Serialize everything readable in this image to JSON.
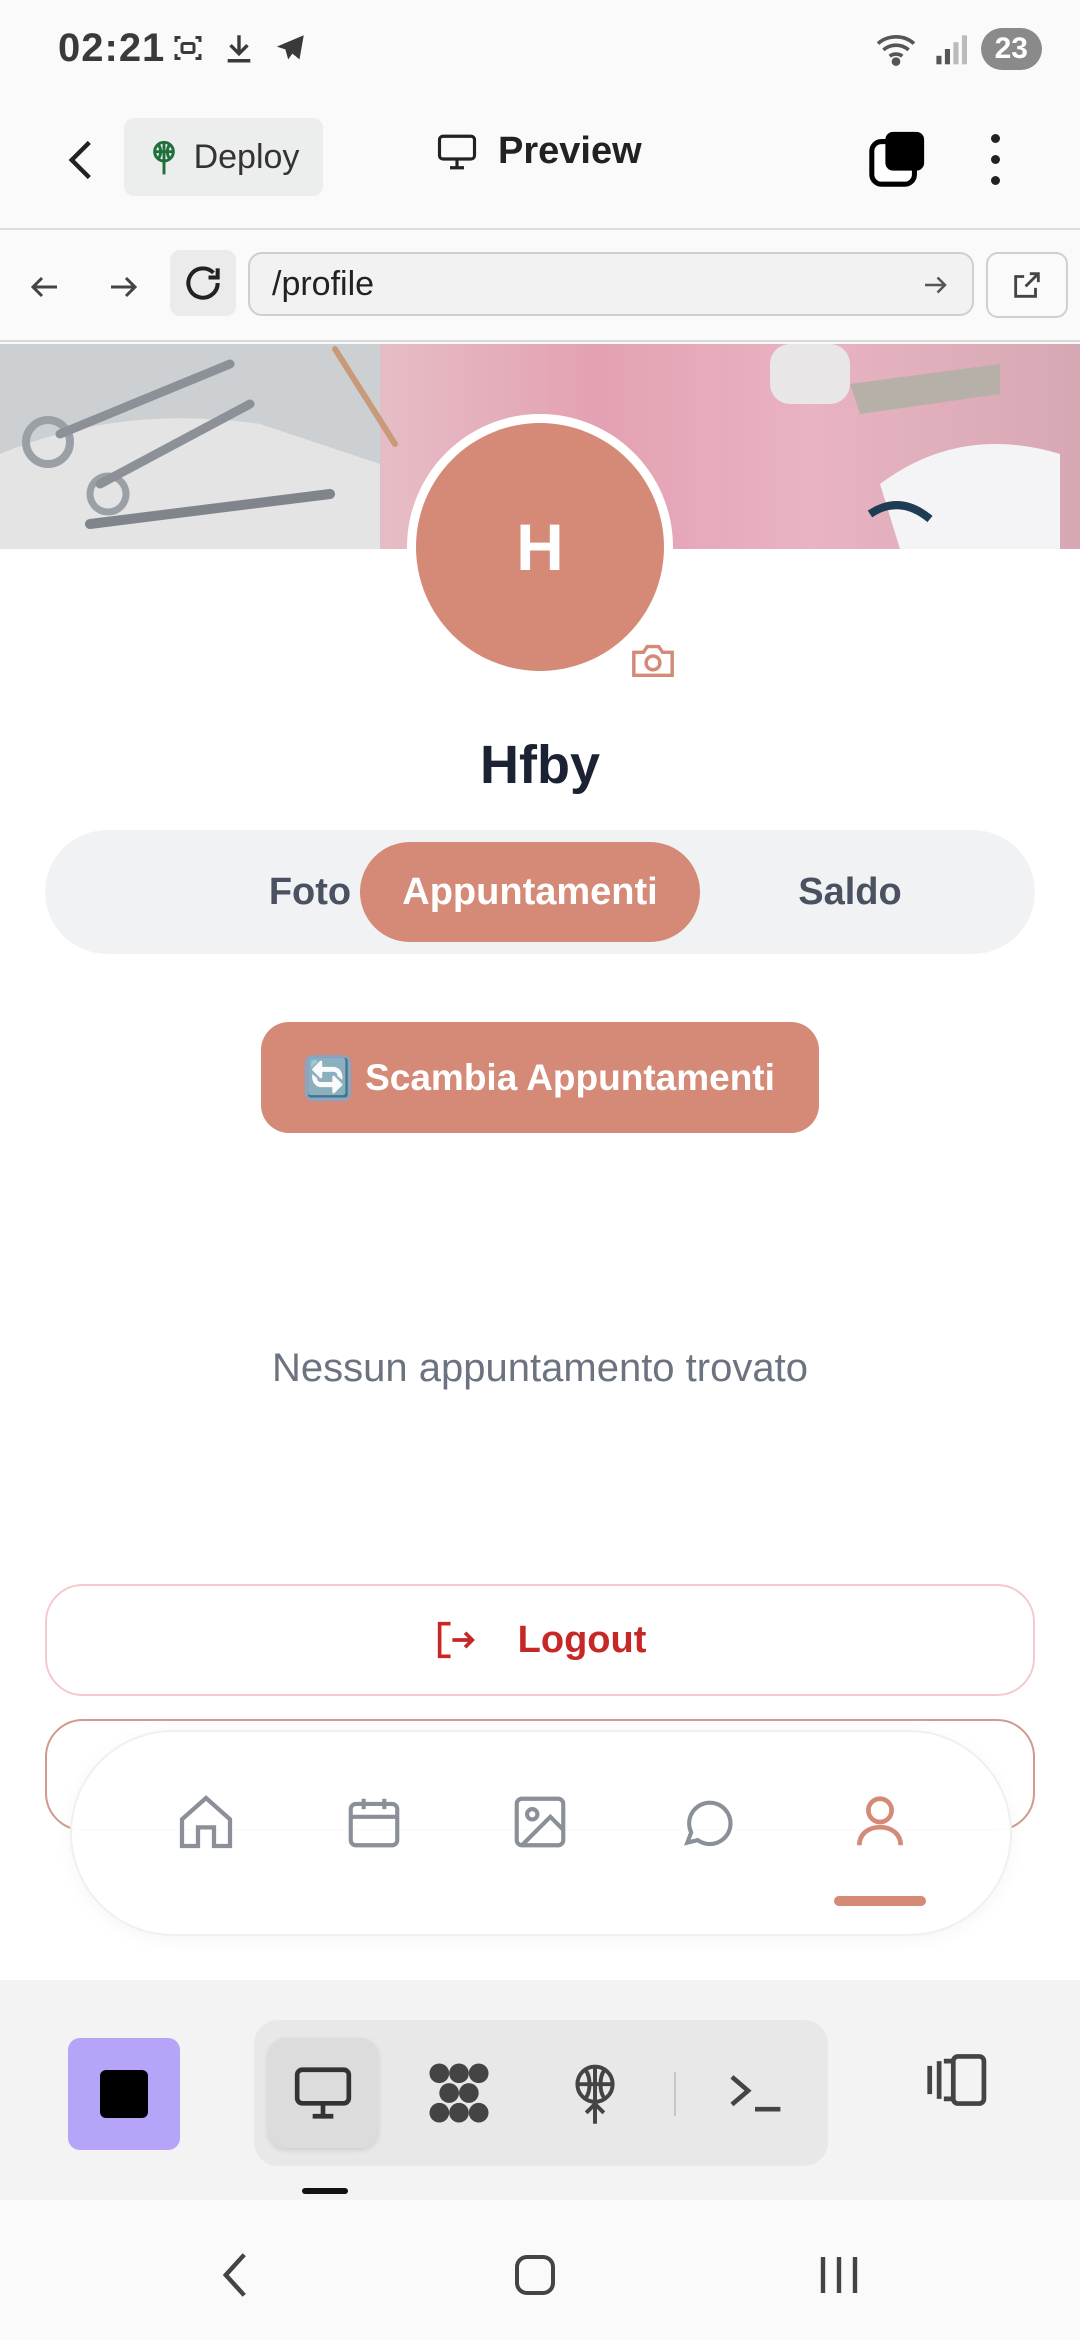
{
  "status_bar": {
    "time": "02:21",
    "battery": "23",
    "icons": [
      "screenshot-icon",
      "download-icon",
      "telegram-icon",
      "wifi-icon",
      "signal-icon"
    ]
  },
  "app_header": {
    "deploy_label": "Deploy",
    "title": "Preview"
  },
  "url_bar": {
    "url": "/profile"
  },
  "profile": {
    "avatar_initial": "H",
    "username": "Hfby",
    "tabs": [
      {
        "label": "Foto",
        "active": false
      },
      {
        "label": "Appuntamenti",
        "active": true
      },
      {
        "label": "Saldo",
        "active": false
      }
    ],
    "swap_button_emoji": "🔄",
    "swap_button_label": "Scambia Appuntamenti",
    "empty_message": "Nessun appuntamento trovato",
    "logout_label": "Logout"
  },
  "bottom_nav": {
    "items": [
      "home-icon",
      "calendar-icon",
      "image-icon",
      "chat-icon",
      "user-icon"
    ],
    "active_index": 4
  },
  "colors": {
    "accent": "#d48a77",
    "logout_red": "#c62828",
    "stop_purple": "#b6a4f8"
  }
}
